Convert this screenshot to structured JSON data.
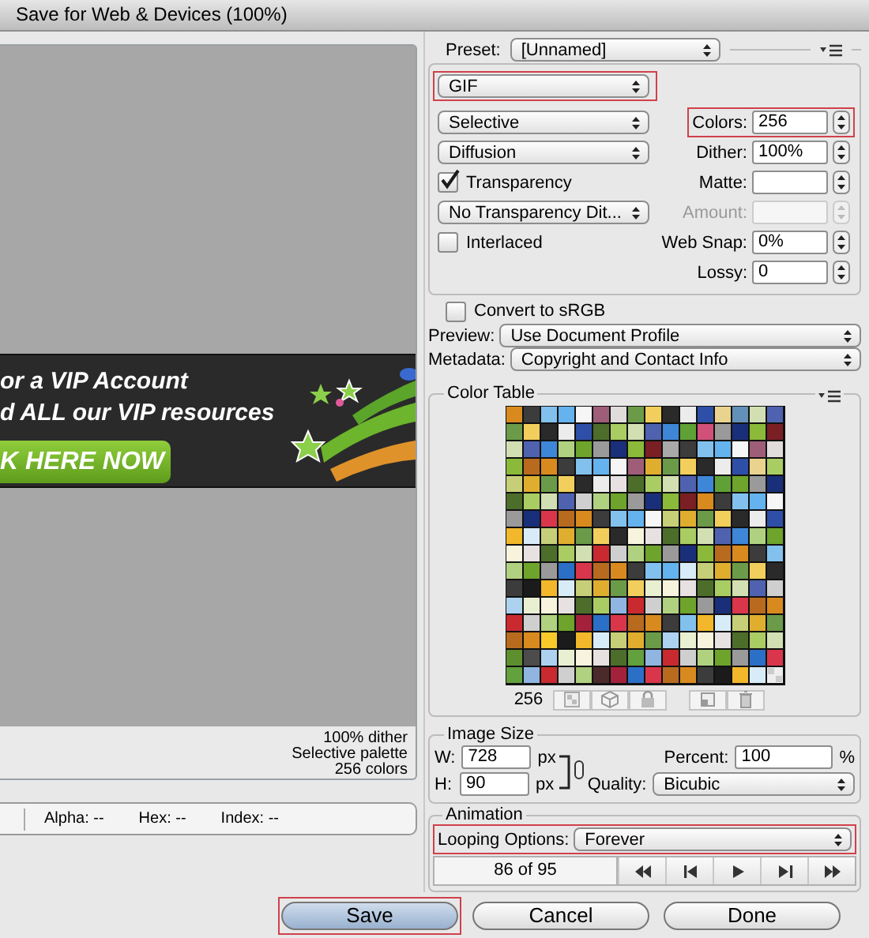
{
  "window": {
    "title": "Save for Web & Devices (100%)"
  },
  "preview": {
    "banner_lines": [
      "or a VIP Account",
      "d ALL our VIP resources"
    ],
    "banner_button": "K HERE NOW",
    "info": [
      "100% dither",
      "Selective palette",
      "256 colors"
    ]
  },
  "status_bar": [
    {
      "label": "Alpha:",
      "value": "--"
    },
    {
      "label": "Hex:",
      "value": "--"
    },
    {
      "label": "Index:",
      "value": "--"
    }
  ],
  "settings": {
    "preset": {
      "label": "Preset:",
      "value": "[Unnamed]"
    },
    "format": {
      "value": "GIF",
      "highlighted": true
    },
    "left_controls": [
      {
        "kind": "select",
        "value": "Selective"
      },
      {
        "kind": "select",
        "value": "Diffusion"
      },
      {
        "kind": "checkbox",
        "label": "Transparency",
        "checked": true
      },
      {
        "kind": "select",
        "value": "No Transparency Dit..."
      },
      {
        "kind": "checkbox",
        "label": "Interlaced",
        "checked": false
      }
    ],
    "right_fields": [
      {
        "label": "Colors:",
        "value": "256",
        "highlighted": true,
        "disabled": false
      },
      {
        "label": "Dither:",
        "value": "100%",
        "highlighted": false,
        "disabled": false
      },
      {
        "label": "Matte:",
        "highlighted": false,
        "disabled": false
      },
      {
        "label": "Amount:",
        "highlighted": false,
        "disabled": true
      },
      {
        "label": "Web Snap:",
        "value": "0%",
        "highlighted": false,
        "disabled": false
      },
      {
        "label": "Lossy:",
        "value": "0",
        "highlighted": false,
        "disabled": false
      }
    ],
    "convert_srgb": {
      "label": "Convert to sRGB",
      "checked": false
    },
    "preview": {
      "label": "Preview:",
      "value": "Use Document Profile"
    },
    "metadata": {
      "label": "Metadata:",
      "value": "Copyright and Contact Info"
    }
  },
  "color_table": {
    "title": "Color Table",
    "count": "256"
  },
  "image_size": {
    "title": "Image Size",
    "width": {
      "label": "W:",
      "value": "728",
      "unit": "px"
    },
    "height": {
      "label": "H:",
      "value": "90",
      "unit": "px"
    },
    "percent": {
      "label": "Percent:",
      "value": "100",
      "unit": "%"
    },
    "quality": {
      "label": "Quality:",
      "value": "Bicubic"
    }
  },
  "animation": {
    "title": "Animation",
    "looping": {
      "label": "Looping Options:",
      "value": "Forever",
      "highlighted": true
    },
    "frame": "86 of 95"
  },
  "buttons": [
    {
      "label": "Save",
      "highlighted": true
    },
    {
      "label": "Cancel",
      "highlighted": false
    },
    {
      "label": "Done",
      "highlighted": false
    }
  ]
}
